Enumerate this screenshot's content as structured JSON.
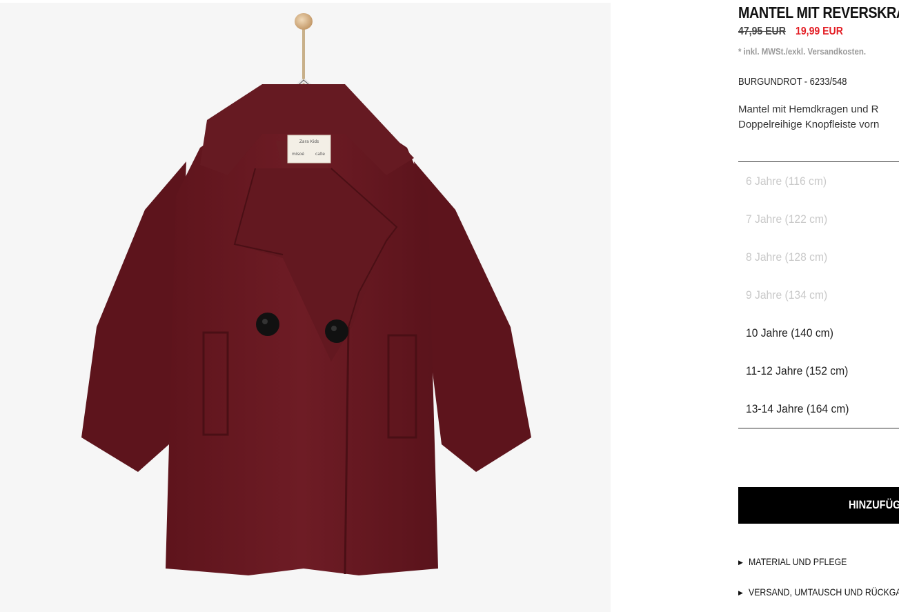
{
  "product": {
    "title": "MANTEL MIT REVERSKRAGEN",
    "old_price": "47,95 EUR",
    "new_price": "19,99 EUR",
    "tax_note": "* inkl. MWSt./exkl. Versandkosten.",
    "color_ref": "BURGUNDROT - 6233/548",
    "description_line1": "Mantel mit Hemdkragen und R",
    "description_line2": "Doppelreihige Knopfleiste vorn"
  },
  "sizes": [
    {
      "label": "6 Jahre (116 cm)",
      "available": false
    },
    {
      "label": "7 Jahre (122 cm)",
      "available": false
    },
    {
      "label": "8 Jahre (128 cm)",
      "available": false
    },
    {
      "label": "9 Jahre (134 cm)",
      "available": false
    },
    {
      "label": "10 Jahre (140 cm)",
      "available": true
    },
    {
      "label": "11-12 Jahre (152 cm)",
      "available": true
    },
    {
      "label": "13-14 Jahre (164 cm)",
      "available": true
    }
  ],
  "add_button": {
    "label": "HINZUFÜGEN"
  },
  "accordions": {
    "material": "MATERIAL UND PFLEGE",
    "shipping": "VERSAND, UMTAUSCH UND RÜCKGABE"
  },
  "coat_label": {
    "brand": "Zara Kids",
    "left": "misoé",
    "right": "calle"
  },
  "colors": {
    "coat": "#6b1a22",
    "price_sale": "#e31c23",
    "button_bg": "#000000"
  }
}
